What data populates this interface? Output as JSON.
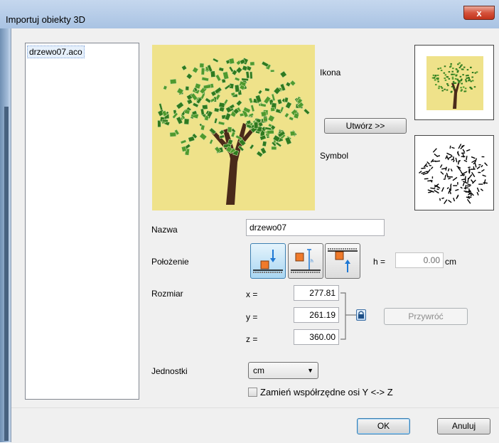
{
  "window": {
    "title": "Importuj obiekty 3D",
    "close_label": "x"
  },
  "file_list": {
    "items": [
      "drzewo07.aco"
    ]
  },
  "labels": {
    "ikona": "Ikona",
    "symbol": "Symbol",
    "nazwa": "Nazwa",
    "polozenie": "Położenie",
    "rozmiar": "Rozmiar",
    "jednostki": "Jednostki",
    "h": "h =",
    "cm": "cm",
    "x": "x =",
    "y": "y =",
    "z": "z ="
  },
  "buttons": {
    "utworz": "Utwórz >>",
    "przywroc": "Przywróć",
    "ok": "OK",
    "anuluj": "Anuluj"
  },
  "fields": {
    "nazwa": "drzewo07",
    "h": "0.00",
    "x": "277.81",
    "y": "261.19",
    "z": "360.00"
  },
  "units": {
    "selected": "cm"
  },
  "checkbox": {
    "label": "Zamień współrzędne osi Y <-> Z",
    "checked": false
  },
  "colors": {
    "preview_bg": "#efe28a",
    "leaf": "#2f7a1f",
    "trunk": "#4a2a1a",
    "window_frame": "#b9cde5"
  }
}
